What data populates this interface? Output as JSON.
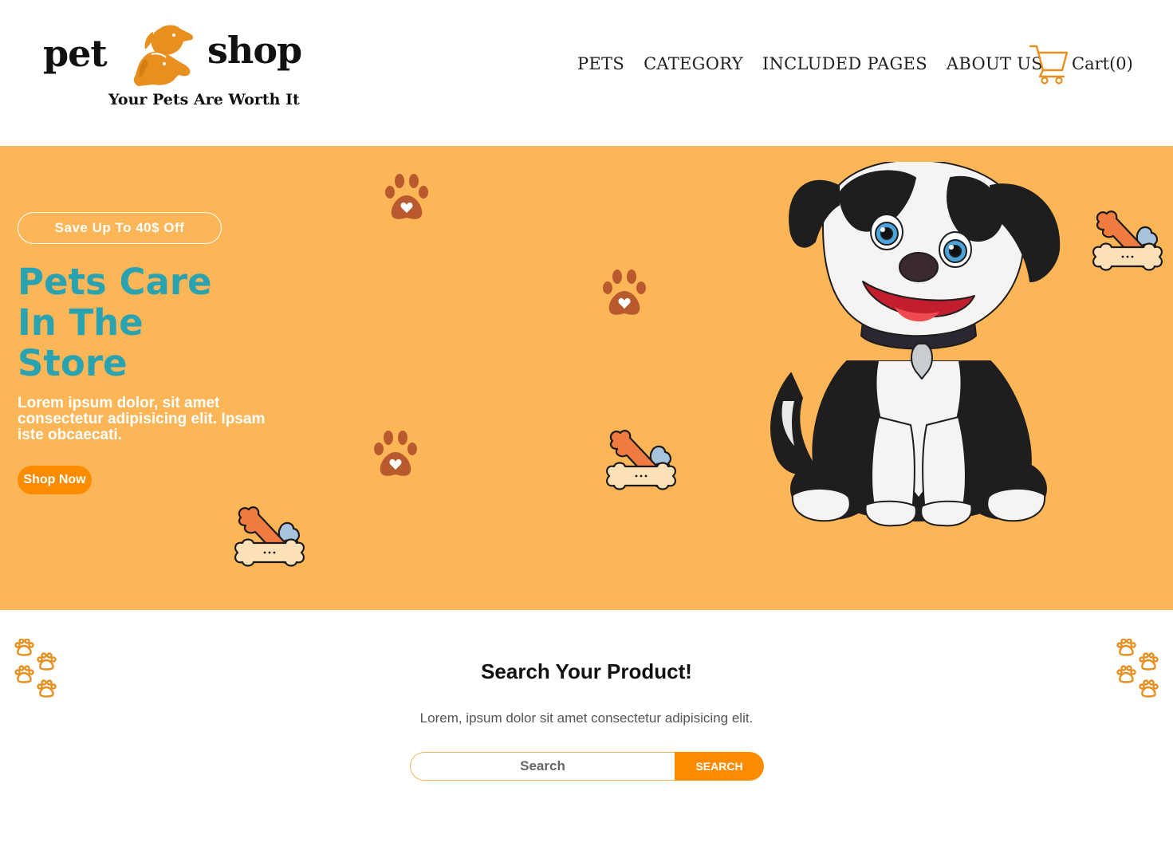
{
  "brand": {
    "word_left": "pet",
    "word_right": "shop",
    "tagline": "Your Pets Are Worth It",
    "icon": "two-dogs-logo-icon"
  },
  "nav": {
    "items": [
      {
        "label": "PETS"
      },
      {
        "label": "CATEGORY"
      },
      {
        "label": "INCLUDED PAGES"
      },
      {
        "label": "ABOUT US"
      }
    ],
    "cart": {
      "label": "Cart(0)",
      "icon": "cart-icon"
    }
  },
  "hero": {
    "promo": "Save Up To 40$ Off",
    "title_lines": [
      "Pets Care",
      "In The",
      "Store"
    ],
    "description": "Lorem ipsum dolor, sit amet consectetur adipisicing elit. Ipsam iste obcaecati.",
    "cta": "Shop Now",
    "illustration": "cartoon-puppy",
    "decorations": [
      "paw-print-icon",
      "bones-icon"
    ]
  },
  "search": {
    "title": "Search Your Product!",
    "subtitle": "Lorem, ipsum dolor sit amet consectetur adipisicing elit.",
    "placeholder": "Search",
    "button": "SEARCH"
  },
  "colors": {
    "hero_bg": "#fdb657",
    "accent": "#fb8c00",
    "title_teal": "#2aa3b1",
    "paw_brown": "#b85a2e",
    "logo_orange": "#e8901f"
  }
}
